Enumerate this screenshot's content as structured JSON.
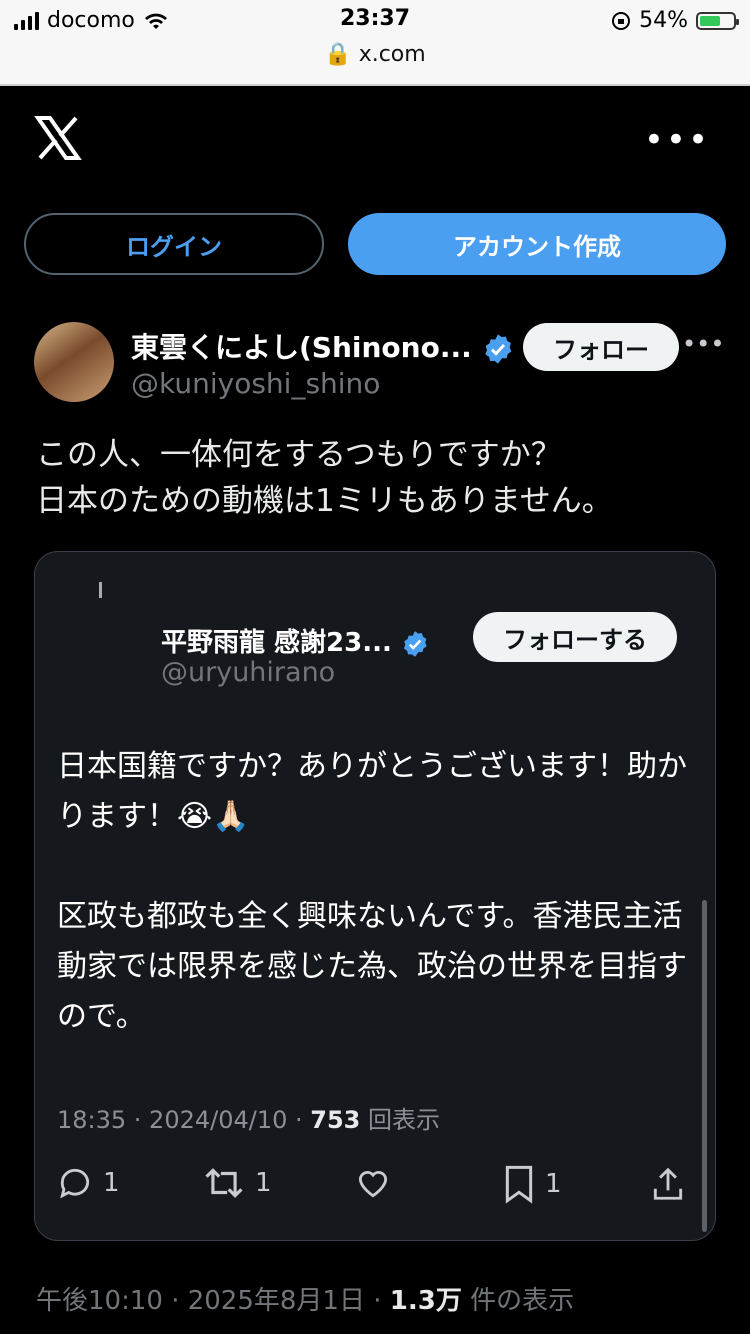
{
  "status_bar": {
    "carrier": "docomo",
    "time": "23:37",
    "battery": "54%",
    "url": "x.com"
  },
  "header": {
    "logo": "x-logo",
    "more": "•••"
  },
  "buttons": {
    "login": "ログイン",
    "signup": "アカウント作成"
  },
  "tweet": {
    "author_name": "東雲くによし(Shinono...",
    "author_handle": "@kuniyoshi_shino",
    "follow": "フォロー",
    "more": "•••",
    "text_line1": "この人、一体何をするつもりですか？",
    "text_line2": "日本のための動機は1ミリもありません。",
    "time": "午後10:10 · 2025年8月1日 · ",
    "views": "1.3万",
    "views_label": " 件の表示"
  },
  "quote": {
    "author_name": "平野雨龍 感謝23...",
    "author_handle": "@uryuhirano",
    "follow": "フォローする",
    "para1": "日本国籍ですか？ありがとうございます！助かります！😭🙏🏻",
    "para2": "区政も都政も全く興味ないんです。香港民主活動家では限界を感じた為、政治の世界を目指すので。",
    "meta_time": "18:35 · 2024/04/10 · ",
    "views": "753",
    "views_label": " 回表示",
    "replies": "1",
    "retweets": "1",
    "bookmarks": "1"
  },
  "colors": {
    "accent": "#4b9ff0",
    "verified": "#4b9ff0",
    "background": "#000000"
  }
}
